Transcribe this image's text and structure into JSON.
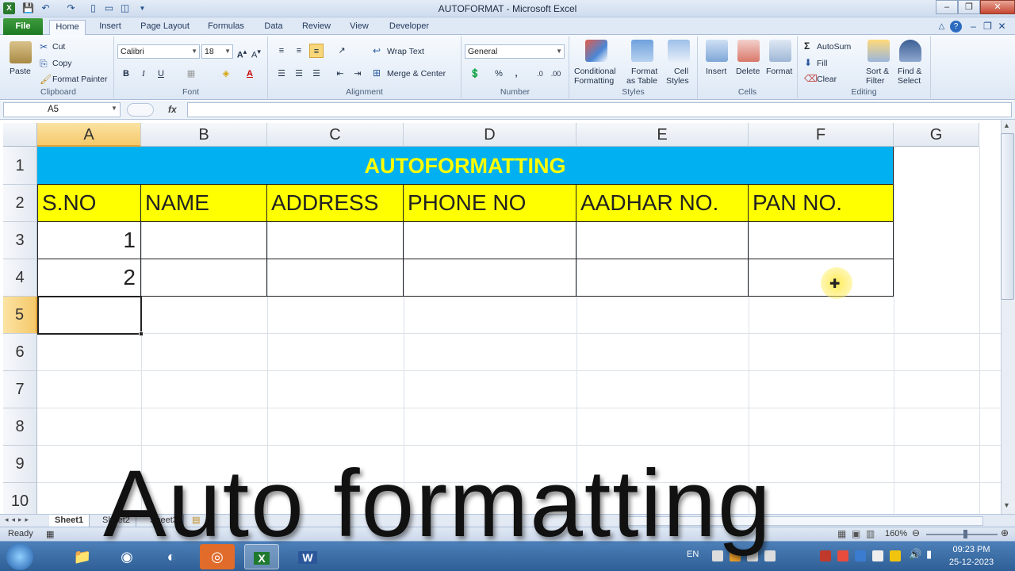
{
  "window": {
    "title": "AUTOFORMAT - Microsoft Excel",
    "minimize": "–",
    "restore": "❐",
    "close": "✕",
    "doc_min": "–",
    "doc_restore": "❐",
    "doc_close": "✕"
  },
  "tabs": [
    "File",
    "Home",
    "Insert",
    "Page Layout",
    "Formulas",
    "Data",
    "Review",
    "View",
    "Developer"
  ],
  "ribbon": {
    "clipboard": {
      "label": "Clipboard",
      "paste": "Paste",
      "cut": "Cut",
      "copy": "Copy",
      "format_painter": "Format Painter"
    },
    "font": {
      "label": "Font",
      "font_name": "Calibri",
      "font_size": "18",
      "bold": "B",
      "italic": "I",
      "underline": "U"
    },
    "alignment": {
      "label": "Alignment",
      "wrap_text": "Wrap Text",
      "merge_center": "Merge & Center"
    },
    "number": {
      "label": "Number",
      "format": "General",
      "percent": "%",
      "comma": ","
    },
    "styles": {
      "label": "Styles",
      "conditional": "Conditional",
      "conditional2": "Formatting",
      "format_table": "Format",
      "format_table2": "as Table",
      "cell_styles": "Cell",
      "cell_styles2": "Styles"
    },
    "cells": {
      "label": "Cells",
      "insert": "Insert",
      "delete": "Delete",
      "format": "Format"
    },
    "editing": {
      "label": "Editing",
      "autosum": "AutoSum",
      "fill": "Fill",
      "clear": "Clear",
      "sort": "Sort &",
      "sort2": "Filter",
      "find": "Find &",
      "find2": "Select"
    }
  },
  "formula_bar": {
    "name_box": "A5",
    "fx": "fx",
    "value": ""
  },
  "columns": [
    "A",
    "B",
    "C",
    "D",
    "E",
    "F",
    "G"
  ],
  "rows": [
    "1",
    "2",
    "3",
    "4",
    "5",
    "6",
    "7",
    "8",
    "9",
    "10"
  ],
  "sheet": {
    "title": "AUTOFORMATTING",
    "headers": [
      "S.NO",
      "NAME",
      "ADDRESS",
      "PHONE NO",
      "AADHAR NO.",
      "PAN NO."
    ],
    "data": [
      [
        "1",
        "",
        "",
        "",
        "",
        ""
      ],
      [
        "2",
        "",
        "",
        "",
        "",
        ""
      ]
    ],
    "active_cell": "A5"
  },
  "sheet_tabs": [
    "Sheet1",
    "Sheet2",
    "Sheet3"
  ],
  "status": {
    "ready": "Ready",
    "zoom": "160%"
  },
  "caption": "Auto formatting",
  "taskbar": {
    "lang": "EN",
    "time": "09:23 PM",
    "date": "25-12-2023"
  },
  "colors": {
    "title_fill": "#00b0f0",
    "title_text": "#ffff00",
    "header_fill": "#ffff00",
    "file_tab": "#2a8a2e"
  }
}
